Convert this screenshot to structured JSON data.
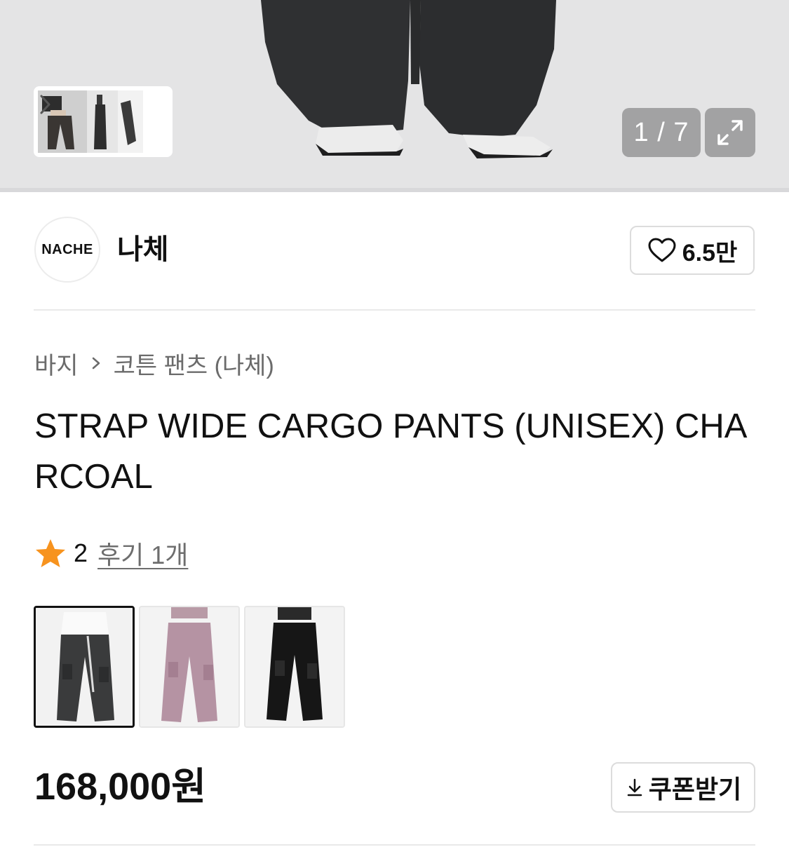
{
  "gallery": {
    "counter": "1 / 7",
    "expand_icon": "expand-icon",
    "thumb_next_icon": "chevron-right-icon"
  },
  "brand": {
    "logo_text": "NACHE",
    "name": "나체",
    "like_count": "6.5만",
    "like_icon": "heart-outline-icon"
  },
  "breadcrumb": {
    "items": [
      "바지",
      "코튼 팬츠 (나체)"
    ],
    "separator_icon": "chevron-right-icon"
  },
  "product": {
    "title": "STRAP WIDE CARGO PANTS (UNISEX) CHARCOAL",
    "rating": "2",
    "review_link": "후기 1개",
    "rating_icon": "star-icon",
    "rating_color": "#F7931E",
    "swatches": [
      "charcoal",
      "pink",
      "black"
    ],
    "selected_swatch": "charcoal",
    "price": "168,000원",
    "coupon_label": "쿠폰받기",
    "coupon_icon": "download-icon"
  }
}
